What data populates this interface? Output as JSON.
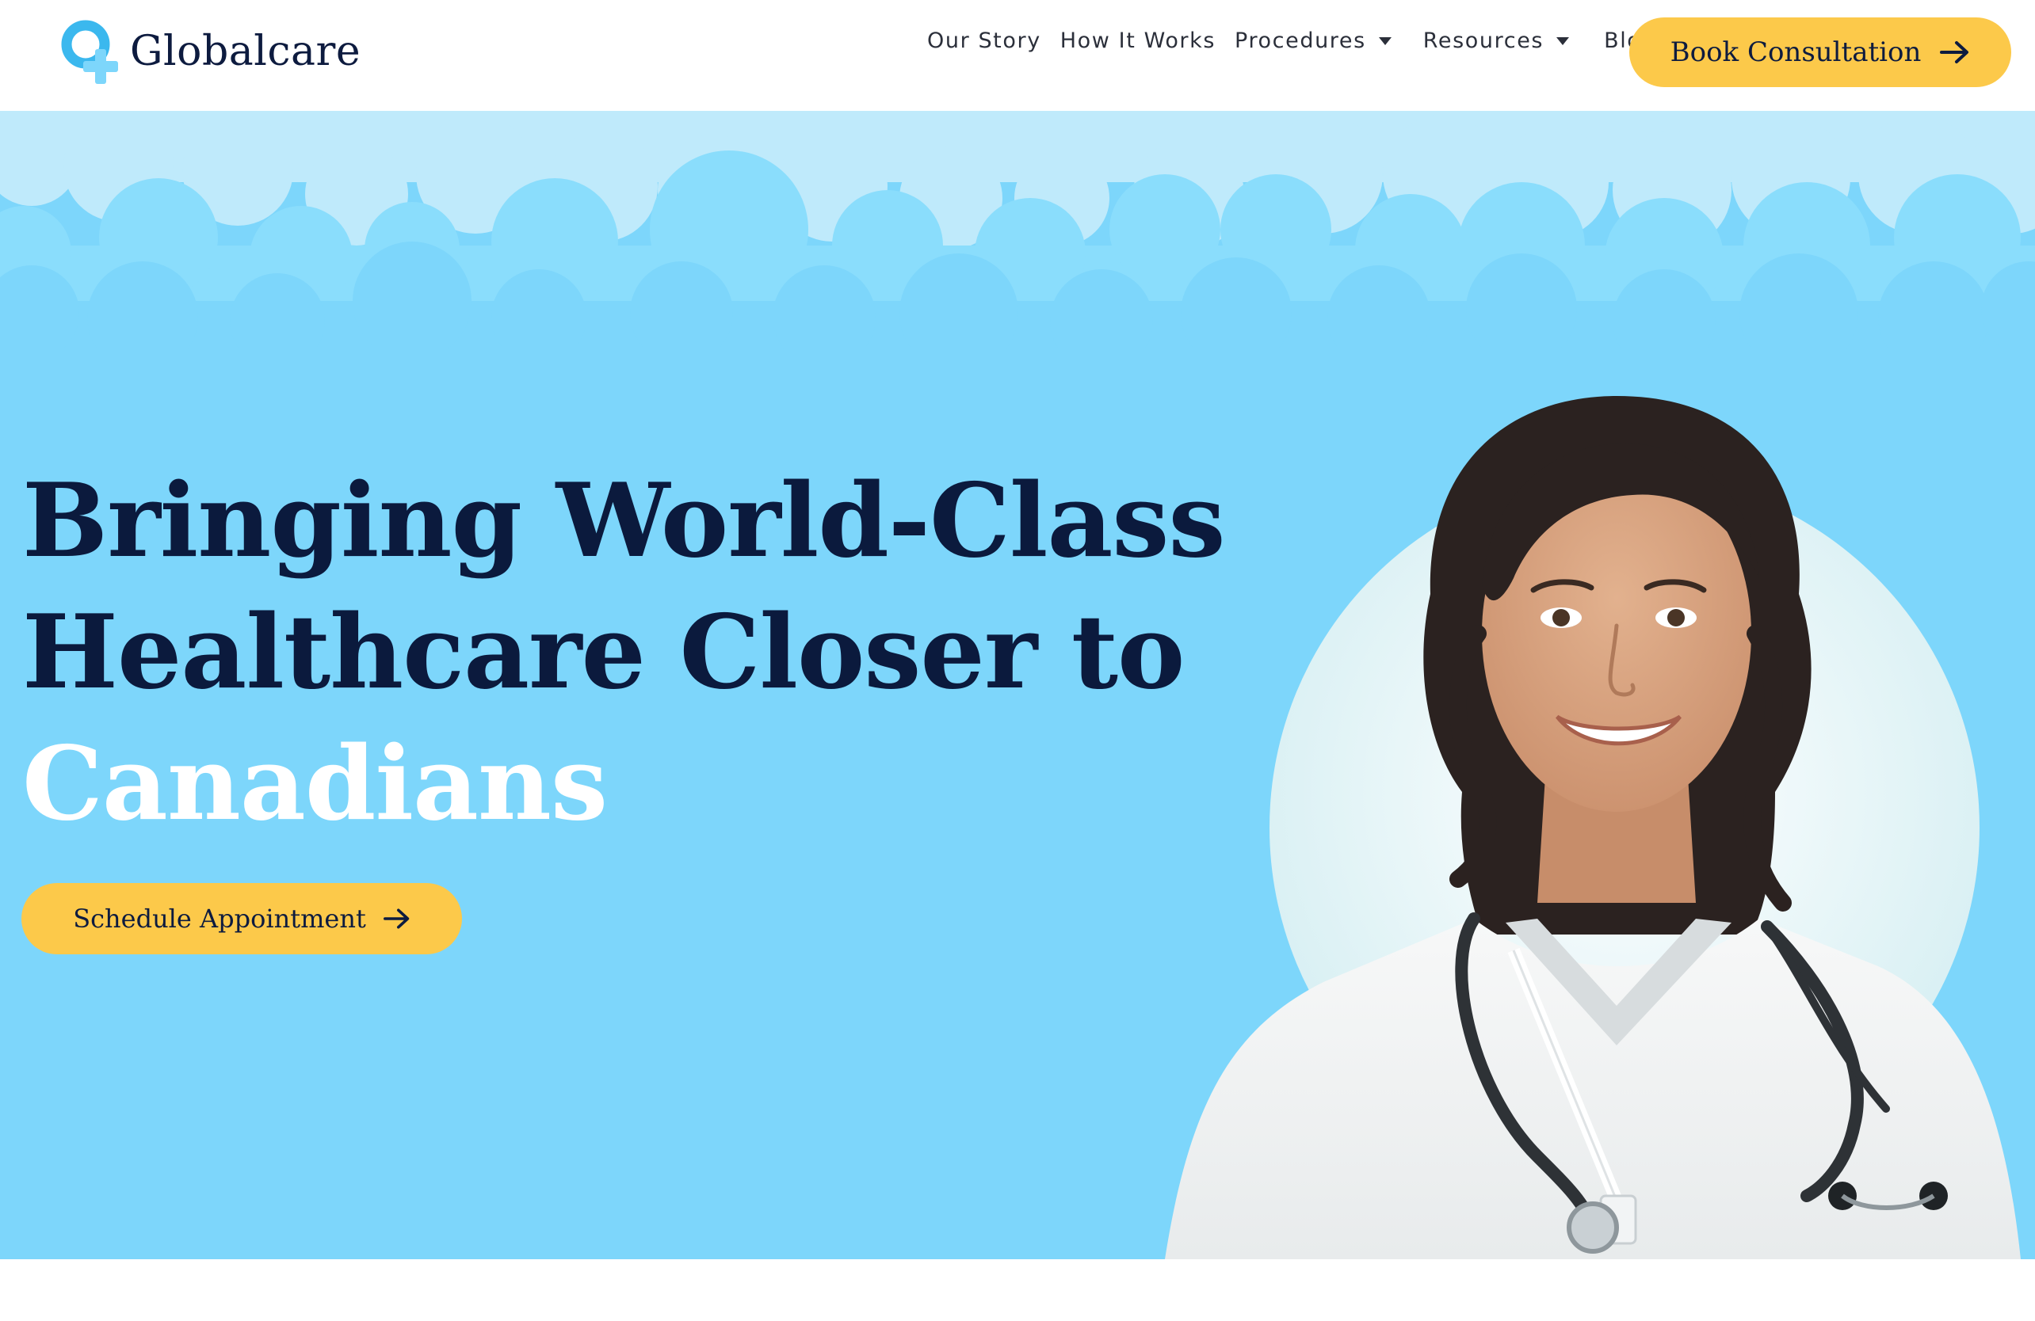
{
  "brand": {
    "name": "Globalcare",
    "logo_icon": "plus-cross-logo-icon",
    "text_color": "#0d1b3f",
    "accent_color": "#3bb8ee"
  },
  "nav": {
    "items": [
      {
        "label": "Our Story",
        "has_dropdown": false
      },
      {
        "label": "How It Works",
        "has_dropdown": false
      },
      {
        "label": "Procedures",
        "has_dropdown": true
      },
      {
        "label": "Resources",
        "has_dropdown": true
      },
      {
        "label": "Blog",
        "has_dropdown": false
      }
    ],
    "dropdown_icon": "caret-down-icon"
  },
  "header_cta": {
    "label": "Book Consultation",
    "icon": "arrow-right-icon",
    "color": "#fcc94a"
  },
  "hero": {
    "headline_line_1": "Bringing World-Class",
    "headline_line_2": "Healthcare Closer to",
    "headline_accent": "Canadians",
    "headline_color": "#0b1a3d",
    "accent_color": "#ffffff",
    "background_color": "#7dd6fb",
    "cta": {
      "label": "Schedule Appointment",
      "icon": "arrow-right-icon"
    },
    "image": "smiling-doctor-with-stethoscope-photo"
  }
}
